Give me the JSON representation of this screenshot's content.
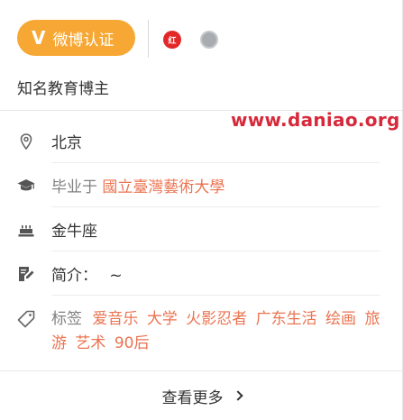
{
  "badge": {
    "label": "微博认证",
    "icon": "v-icon"
  },
  "medals": [
    {
      "name": "red-medal-icon",
      "label": "红",
      "color": "#e22828"
    },
    {
      "name": "silver-medal-icon",
      "label": "",
      "color": "#a8acb0"
    }
  ],
  "intro": "知名教育博主",
  "watermark": "www.daniao.org",
  "info": {
    "location": {
      "icon": "location-pin-icon",
      "text": "北京"
    },
    "education": {
      "icon": "graduation-cap-icon",
      "prefix": "毕业于",
      "school": "國立臺灣藝術大學"
    },
    "birthday": {
      "icon": "cake-icon",
      "text": "金牛座"
    },
    "bio": {
      "icon": "edit-icon",
      "label": "简介：",
      "value": "~"
    },
    "tags": {
      "icon": "tag-icon",
      "label": "标签",
      "items": [
        "爱音乐",
        "大学",
        "火影忍者",
        "广东生活",
        "绘画",
        "旅游",
        "艺术",
        "90后"
      ]
    }
  },
  "more": {
    "label": "查看更多"
  },
  "colors": {
    "accent": "#eb7350",
    "badge": "#f7a733",
    "watermark": "#d6293b"
  }
}
